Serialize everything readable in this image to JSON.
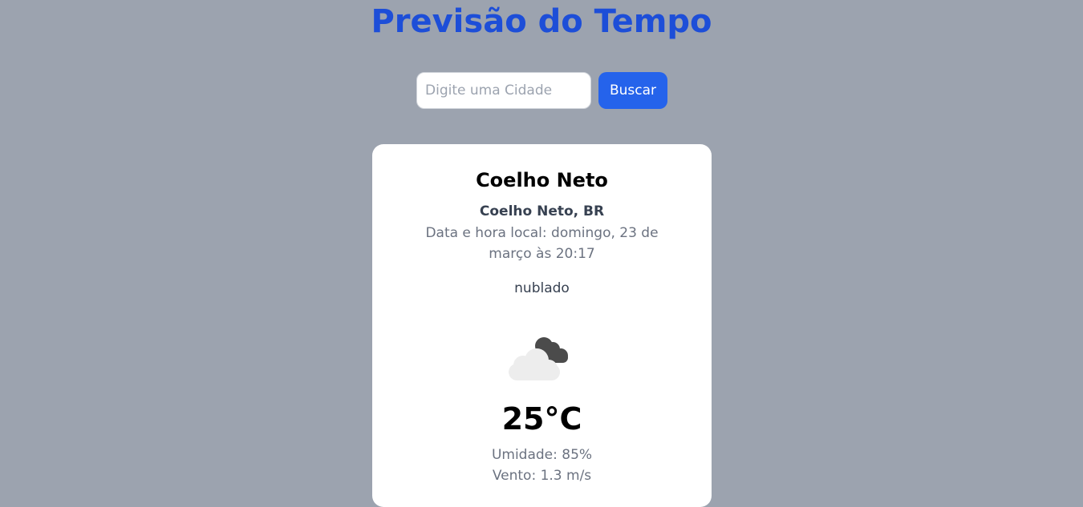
{
  "header": {
    "title": "Previsão do Tempo"
  },
  "search": {
    "placeholder": "Digite uma Cidade",
    "value": "",
    "button_label": "Buscar"
  },
  "weather": {
    "city": "Coelho Neto",
    "city_country": "Coelho Neto, BR",
    "local_datetime": "Data e hora local: domingo, 23 de março às 20:17",
    "description": "nublado",
    "icon": "broken-clouds-icon",
    "temperature": "25°C",
    "humidity": "Umidade: 85%",
    "wind": "Vento: 1.3 m/s"
  },
  "colors": {
    "background": "#9ca3af",
    "title": "#1d4ed8",
    "button": "#2563eb",
    "card": "#ffffff"
  }
}
